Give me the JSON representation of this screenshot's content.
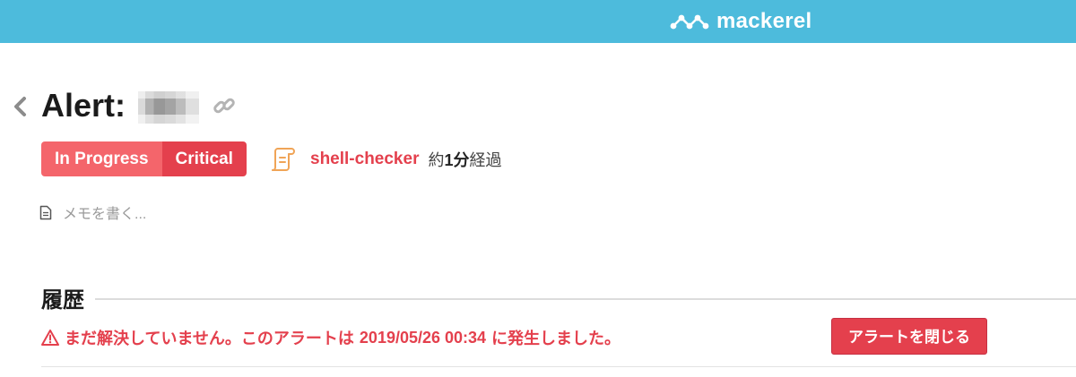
{
  "header": {
    "logo_text": "mackerel",
    "logo_icon": "mackerel-wave-icon"
  },
  "alert": {
    "title": "Alert:",
    "back_icon": "chevron-left-icon",
    "link_icon": "link-icon",
    "status_label": "In Progress",
    "severity_label": "Critical",
    "monitor_icon": "scroll-icon",
    "monitor_name": "shell-checker",
    "elapsed_prefix": "約",
    "elapsed_value": "1分",
    "elapsed_suffix": "経過"
  },
  "memo": {
    "icon": "document-icon",
    "placeholder": "メモを書く..."
  },
  "history": {
    "title": "履歴",
    "warning_icon": "warning-icon",
    "message_prefix": "まだ解決していません。このアラートは",
    "message_datetime": "2019/05/26 00:34",
    "message_suffix": "に発生しました。",
    "close_button_label": "アラートを閉じる"
  },
  "colors": {
    "brand": "#4dbbdc",
    "status_badge": "#f4656b",
    "critical": "#e4404d",
    "monitor_icon": "#f0a457"
  }
}
